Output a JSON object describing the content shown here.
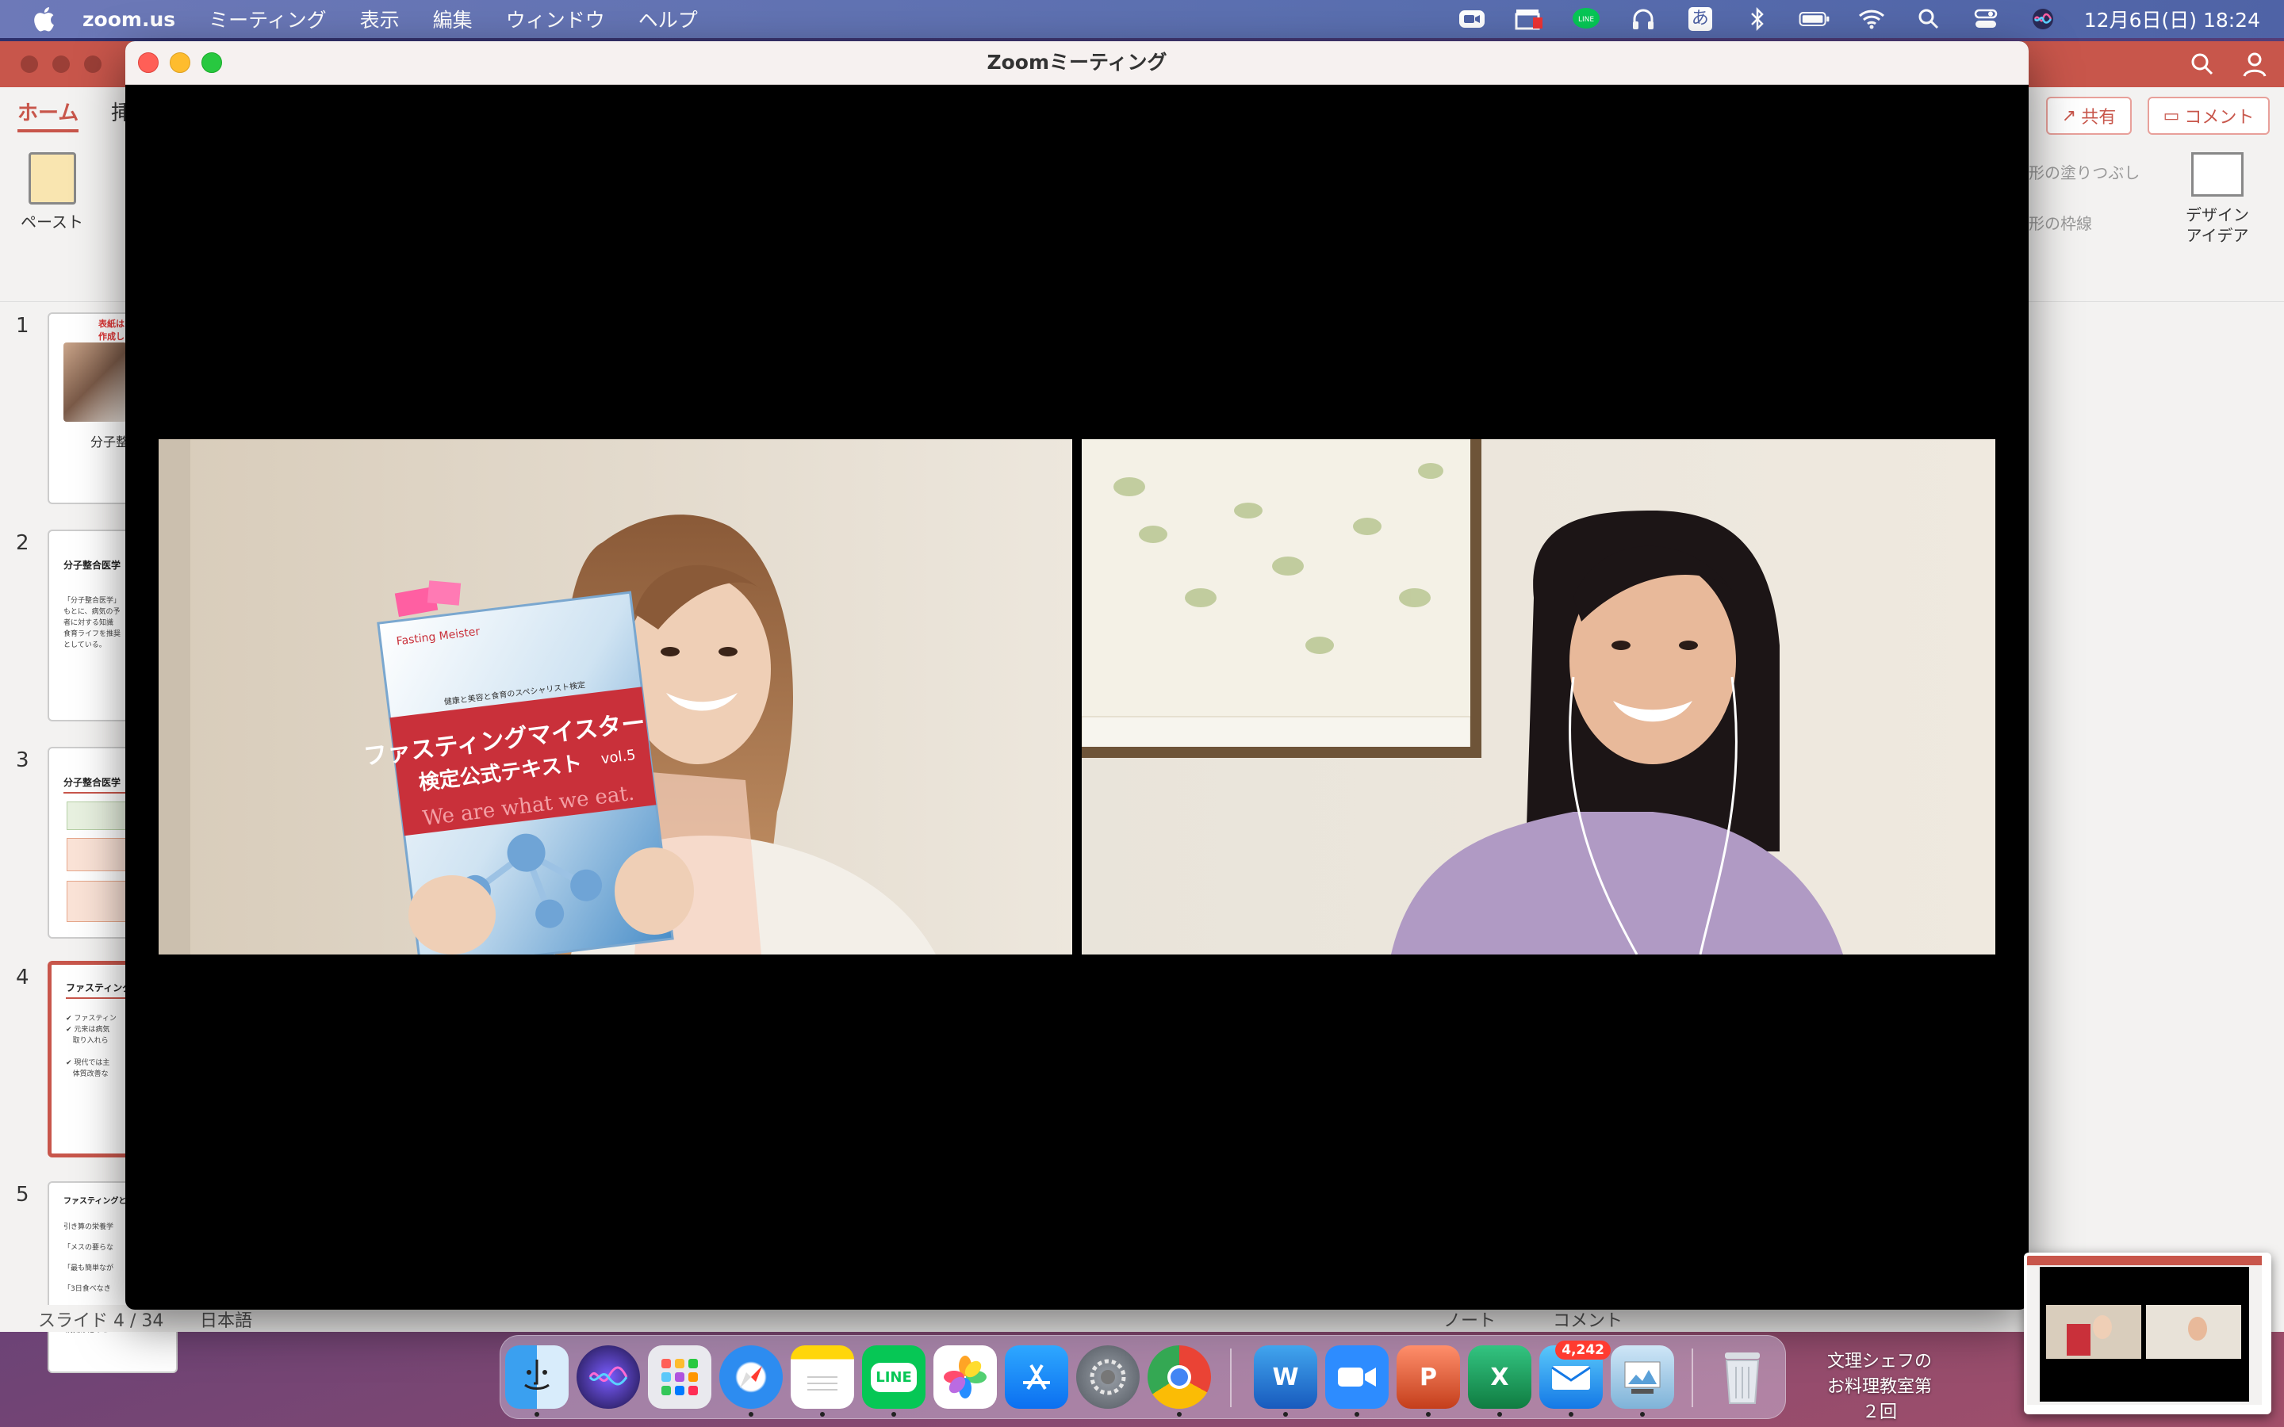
{
  "menubar": {
    "app_name": "zoom.us",
    "items": [
      "ミーティング",
      "表示",
      "編集",
      "ウィンドウ",
      "ヘルプ"
    ],
    "status_icons": [
      "zoom-icon",
      "clapper-icon",
      "line-icon",
      "headphones-icon",
      "input-method-icon",
      "bluetooth-icon",
      "battery-icon",
      "wifi-icon",
      "spotlight-search-icon",
      "control-center-icon",
      "siri-icon"
    ],
    "input_method": "あ",
    "line_label": "LINE",
    "clock": "12月6日(日)  18:24"
  },
  "powerpoint": {
    "tabs": [
      "ホーム",
      "挿"
    ],
    "paste_label": "ペースト",
    "share_label": "共有",
    "comment_label": "コメント",
    "shape_fill": "形の塗りつぶし",
    "shape_line": "形の枠線",
    "design_ideas": [
      "デザイン",
      "アイデア"
    ],
    "slides": [
      {
        "num": "1",
        "title": "表紙は",
        "title2": "作成し",
        "subtitle": "分子整"
      },
      {
        "num": "2",
        "title": "分子整合医学",
        "text": "「分子整合医学」\nもとに、病気の予\n者に対する知識\n食育ライフを推奨\nとしている。"
      },
      {
        "num": "3",
        "title": "分子整合医学"
      },
      {
        "num": "4",
        "title": "ファスティング",
        "text": "✔ ファスティン\n✔ 元来は病気\n   取り入れら\n\n✔ 現代では主\n   体質改善な"
      },
      {
        "num": "5",
        "title": "ファスティングとは",
        "text": "引き算の栄養学\n「メスの要らな\n「最も簡単なが\n「3日食べなき\n「ファスティン\n 病気は他のと"
      }
    ],
    "status": {
      "slide": "スライド 4 / 34",
      "language": "日本語",
      "notes": "ノート",
      "comments": "コメント"
    }
  },
  "zoom": {
    "title": "Zoomミーティング",
    "participants": [
      {
        "name": "participant-left",
        "book_brand": "Fasting Meister",
        "book_top": "健康と美容と食育のスペシャリスト検定",
        "book_title1": "ファスティングマイスター",
        "book_title2": "検定公式テキスト",
        "book_vol": "vol.5",
        "book_slogan": "We are what we eat."
      },
      {
        "name": "participant-right"
      }
    ]
  },
  "dock": {
    "apps": [
      "finder-icon",
      "siri-icon",
      "launchpad-icon",
      "safari-icon",
      "notes-icon",
      "line-icon",
      "photos-icon",
      "app-store-icon",
      "system-preferences-icon",
      "chrome-icon",
      "word-icon",
      "zoom-icon",
      "powerpoint-icon",
      "excel-icon",
      "mail-icon",
      "preview-icon",
      "trash-icon"
    ],
    "line_label": "LINE",
    "word_letter": "W",
    "powerpoint_letter": "P",
    "excel_letter": "X",
    "mail_badge": "4,242"
  },
  "desktop": {
    "folder_label": "文理シェフのお料理教室第２回"
  },
  "colors": {
    "zoom_title_bg": "#f6f1f0",
    "ppt_accent": "#c8564b",
    "traffic_close": "#ff5f57",
    "traffic_min": "#febc2e",
    "traffic_max": "#28c840"
  }
}
